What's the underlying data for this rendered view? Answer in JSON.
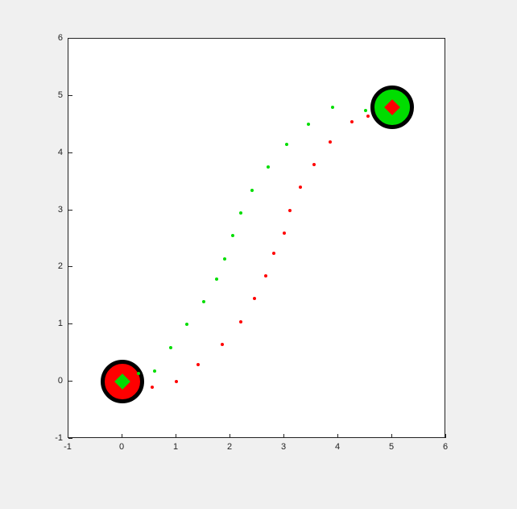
{
  "chart_data": {
    "type": "scatter",
    "xlim": [
      -1,
      6
    ],
    "ylim": [
      -1,
      6
    ],
    "xticks": [
      -1,
      0,
      1,
      2,
      3,
      4,
      5,
      6
    ],
    "yticks": [
      -1,
      0,
      1,
      2,
      3,
      4,
      5,
      6
    ],
    "markers": [
      {
        "name": "start-circle",
        "x": 0,
        "y": 0,
        "fill": "#ff0000",
        "diamond_fill": "#00dd00"
      },
      {
        "name": "end-circle",
        "x": 5,
        "y": 4.8,
        "fill": "#00dd00",
        "diamond_fill": "#ff0000"
      }
    ],
    "series": [
      {
        "name": "green-path",
        "color": "#00dd00",
        "points": [
          [
            0.3,
            0.15
          ],
          [
            0.6,
            0.18
          ],
          [
            0.9,
            0.6
          ],
          [
            1.2,
            1.0
          ],
          [
            1.5,
            1.4
          ],
          [
            1.75,
            1.8
          ],
          [
            1.9,
            2.15
          ],
          [
            2.05,
            2.55
          ],
          [
            2.2,
            2.95
          ],
          [
            2.4,
            3.35
          ],
          [
            2.7,
            3.75
          ],
          [
            3.05,
            4.15
          ],
          [
            3.45,
            4.5
          ],
          [
            3.9,
            4.8
          ],
          [
            4.5,
            4.75
          ]
        ]
      },
      {
        "name": "red-path",
        "color": "#ff0000",
        "points": [
          [
            0.55,
            -0.1
          ],
          [
            1.0,
            0.0
          ],
          [
            1.4,
            0.3
          ],
          [
            1.85,
            0.65
          ],
          [
            2.2,
            1.05
          ],
          [
            2.45,
            1.45
          ],
          [
            2.65,
            1.85
          ],
          [
            2.8,
            2.25
          ],
          [
            3.0,
            2.6
          ],
          [
            3.1,
            3.0
          ],
          [
            3.3,
            3.4
          ],
          [
            3.55,
            3.8
          ],
          [
            3.85,
            4.2
          ],
          [
            4.25,
            4.55
          ],
          [
            4.55,
            4.65
          ]
        ]
      }
    ]
  }
}
